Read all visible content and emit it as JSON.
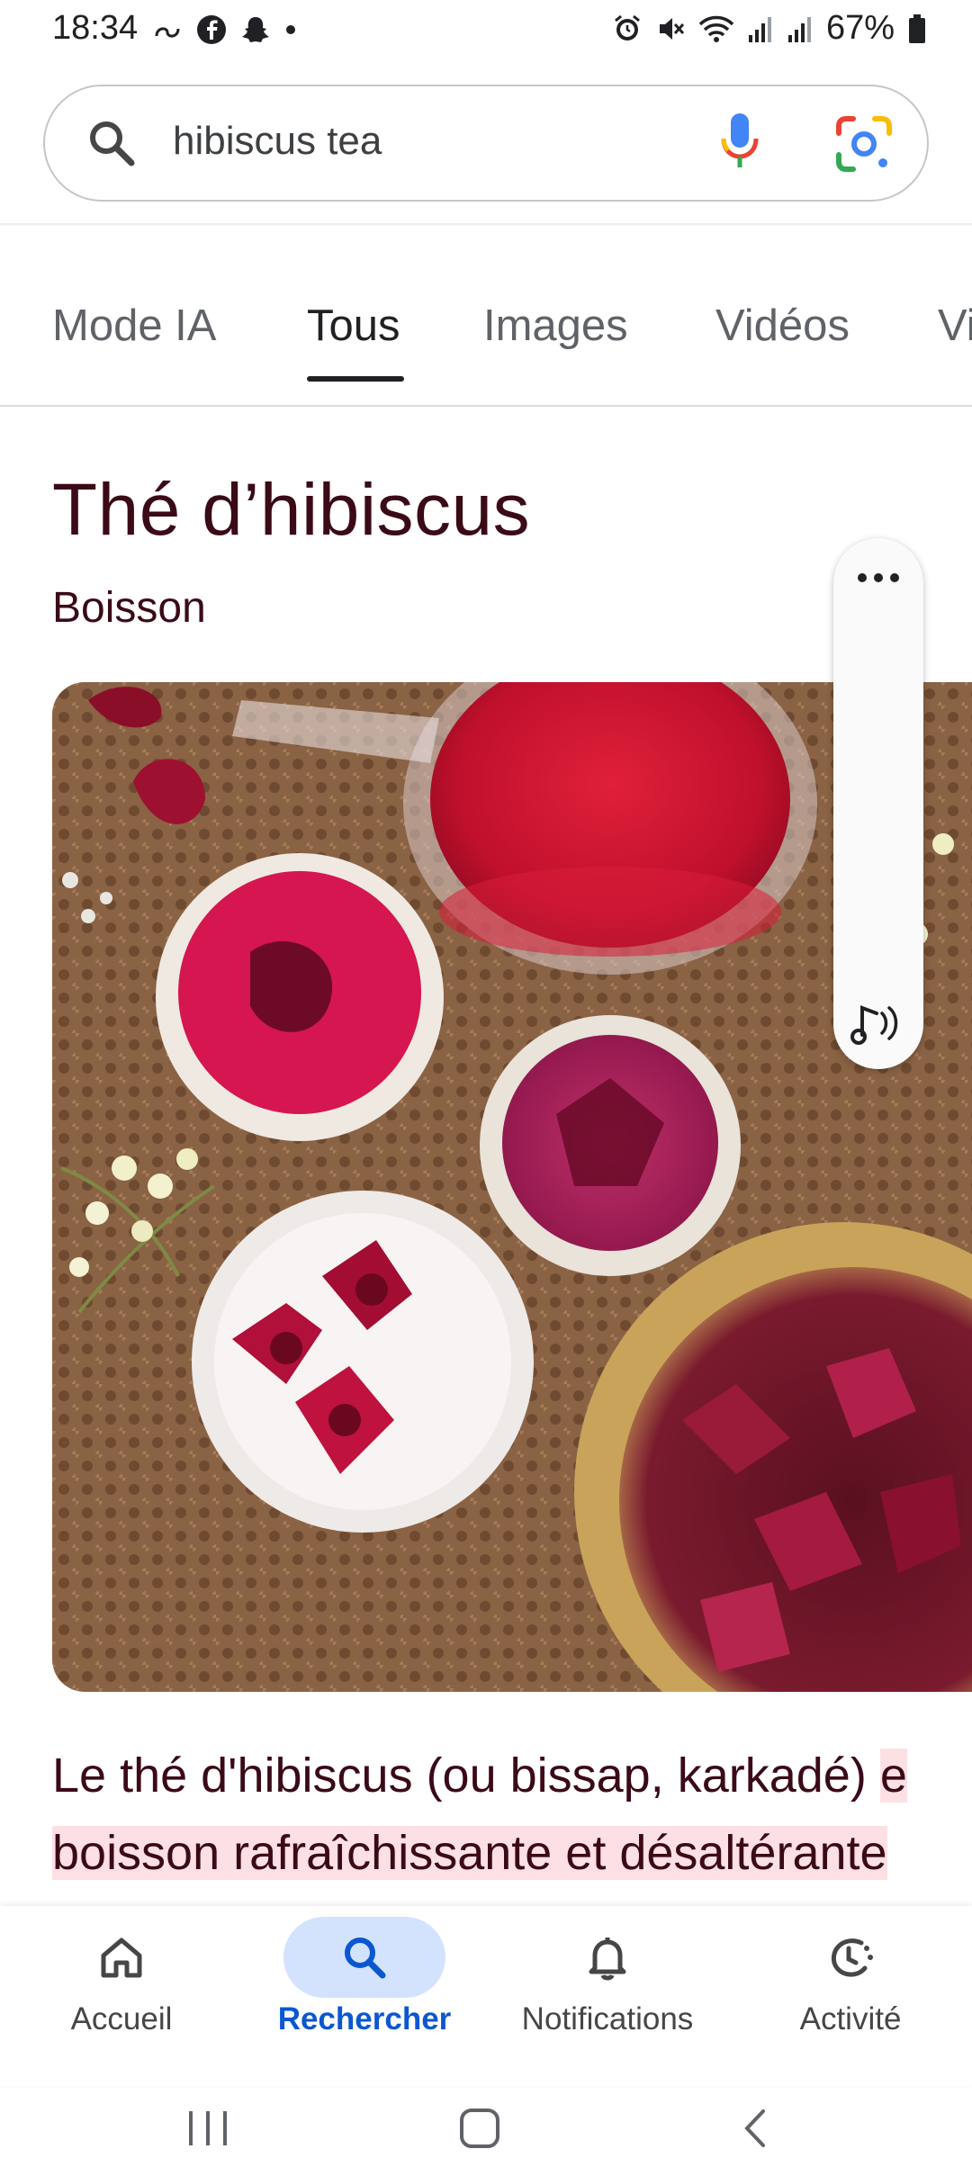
{
  "status_bar": {
    "time": "18:34",
    "battery": "67%"
  },
  "search": {
    "query": "hibiscus tea"
  },
  "tabs": [
    {
      "label": "Mode IA"
    },
    {
      "label": "Tous",
      "active": true
    },
    {
      "label": "Images"
    },
    {
      "label": "Vidéos"
    },
    {
      "label": "Vi"
    }
  ],
  "knowledge_panel": {
    "title": "Thé d’hibiscus",
    "subtitle": "Boisson",
    "description_line1_a": "Le thé d'hibiscus (ou bissap, karkadé) ",
    "description_line1_b": "e",
    "description_line2": "boisson rafraîchissante et désaltérante"
  },
  "bottom_nav": [
    {
      "label": "Accueil",
      "icon": "home-icon"
    },
    {
      "label": "Rechercher",
      "icon": "search-icon",
      "active": true
    },
    {
      "label": "Notifications",
      "icon": "bell-icon"
    },
    {
      "label": "Activité",
      "icon": "activity-icon"
    }
  ],
  "colors": {
    "accent": "#0b57d0",
    "title": "#3b0a17",
    "highlight": "#fde0e4"
  }
}
